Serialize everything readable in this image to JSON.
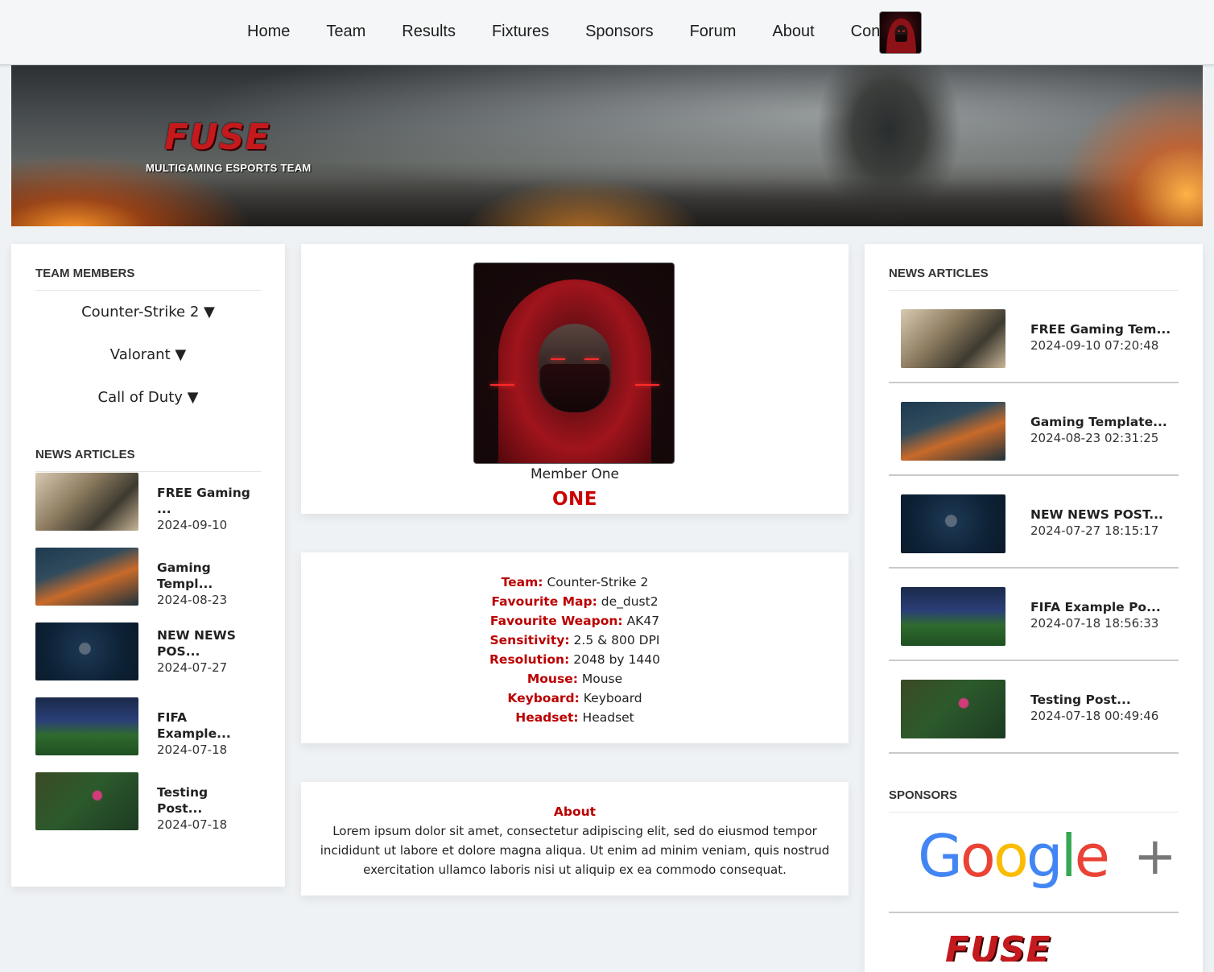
{
  "nav": {
    "links": [
      "Home",
      "Team",
      "Results",
      "Fixtures",
      "Sponsors",
      "Forum",
      "About",
      "Contact"
    ]
  },
  "banner": {
    "logo": "FUSE",
    "tagline": "MULTIGAMING ESPORTS TEAM"
  },
  "left": {
    "team_members_title": "TEAM MEMBERS",
    "dropdowns": [
      "Counter-Strike 2 ▼",
      "Valorant ▼",
      "Call of Duty ▼"
    ],
    "news_title": "NEWS ARTICLES",
    "news": [
      {
        "title": "FREE Gaming ...",
        "date": "2024-09-10"
      },
      {
        "title": "Gaming Templ...",
        "date": "2024-08-23"
      },
      {
        "title": "NEW NEWS POS...",
        "date": "2024-07-27"
      },
      {
        "title": "FIFA Example...",
        "date": "2024-07-18"
      },
      {
        "title": "Testing Post...",
        "date": "2024-07-18"
      }
    ]
  },
  "profile": {
    "name": "Member One",
    "tag": "ONE"
  },
  "stats": [
    {
      "label": "Team:",
      "value": "Counter-Strike 2"
    },
    {
      "label": "Favourite Map:",
      "value": "de_dust2"
    },
    {
      "label": "Favourite Weapon:",
      "value": "AK47"
    },
    {
      "label": "Sensitivity:",
      "value": "2.5 & 800 DPI"
    },
    {
      "label": "Resolution:",
      "value": "2048 by 1440"
    },
    {
      "label": "Mouse:",
      "value": "Mouse"
    },
    {
      "label": "Keyboard:",
      "value": "Keyboard"
    },
    {
      "label": "Headset:",
      "value": "Headset"
    }
  ],
  "about": {
    "title": "About",
    "body": "Lorem ipsum dolor sit amet, consectetur adipiscing elit, sed do eiusmod tempor incididunt ut labore et dolore magna aliqua. Ut enim ad minim veniam, quis nostrud exercitation ullamco laboris nisi ut aliquip ex ea commodo consequat."
  },
  "right": {
    "news_title": "NEWS ARTICLES",
    "news": [
      {
        "title": "FREE Gaming Tem...",
        "date": "2024-09-10 07:20:48"
      },
      {
        "title": "Gaming Template...",
        "date": "2024-08-23 02:31:25"
      },
      {
        "title": "NEW NEWS POST...",
        "date": "2024-07-27 18:15:17"
      },
      {
        "title": "FIFA Example Po...",
        "date": "2024-07-18 18:56:33"
      },
      {
        "title": "Testing Post...",
        "date": "2024-07-18 00:49:46"
      }
    ],
    "sponsors_title": "SPONSORS",
    "sponsor_logos": [
      "Google+",
      "FUSE"
    ]
  },
  "colors": {
    "accent_red": "#bb0000",
    "page_bg": "#eff2f5"
  }
}
